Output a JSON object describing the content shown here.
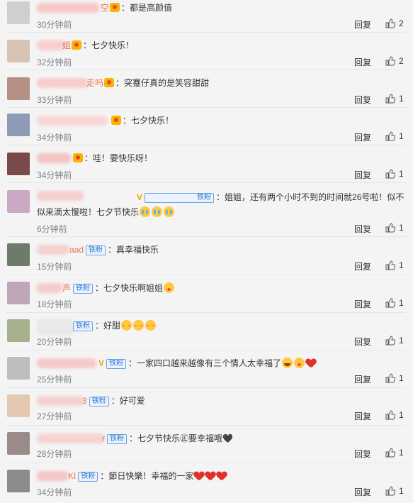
{
  "actions": {
    "reply_label": "回复"
  },
  "comments": [
    {
      "name": "空",
      "fan": "",
      "v": false,
      "text": "：都是高颜值",
      "time": "30分钟前",
      "likes": "2",
      "avatar_color": "#cfcfcf",
      "name_blur_color": "#f6c7c7"
    },
    {
      "name": "姐",
      "fan": "",
      "v": false,
      "text": "：七夕快乐！",
      "time": "32分钟前",
      "likes": "2",
      "avatar_color": "#d9c3b3",
      "name_blur_color": "#f7cfd0"
    },
    {
      "name": "走吗",
      "fan": "",
      "v": false,
      "text": "：突蹇仔真的是笑容甜甜",
      "time": "33分钟前",
      "likes": "1",
      "avatar_color": "#b58f83",
      "name_blur_color": "#f7cccc"
    },
    {
      "name": "",
      "fan": "",
      "v": false,
      "text": "：七夕快乐！",
      "time": "34分钟前",
      "likes": "1",
      "avatar_color": "#8e9bb5",
      "name_blur_color": "#f9d6d6"
    },
    {
      "name": "",
      "fan": "",
      "v": false,
      "text": "：哇！要快乐呀！",
      "time": "34分钟前",
      "likes": "1",
      "avatar_color": "#7a4a4a",
      "name_blur_color": "#f5c4c4"
    },
    {
      "name": "",
      "fan": "铁粉",
      "v": true,
      "text": "：姐姐，还有两个小时不到的时间就26号啦！似不似来滴太慢啦！七夕节快乐",
      "time": "6分钟前",
      "likes": "1",
      "avatar_color": "#c9a9c4",
      "name_blur_color": "#f6cfcf"
    },
    {
      "name": "aad",
      "fan": "铁粉",
      "v": false,
      "text": "：真幸福快乐",
      "time": "15分钟前",
      "likes": "1",
      "avatar_color": "#6f7b6a",
      "name_blur_color": "#f3d2d2"
    },
    {
      "name": "声",
      "fan": "铁粉",
      "v": false,
      "text": "：七夕快乐啊姐姐",
      "time": "18分钟前",
      "likes": "1",
      "avatar_color": "#bfa6b8",
      "name_blur_color": "#f5cccc"
    },
    {
      "name": "",
      "fan": "铁粉",
      "v": false,
      "text": "：好甜",
      "time": "20分钟前",
      "likes": "1",
      "avatar_color": "#a7b08c",
      "name_blur_color": "#e9e9e9"
    },
    {
      "name": "",
      "fan": "铁粉",
      "v": true,
      "text": "：一家四口越来越像有三个情人太幸福了",
      "time": "25分钟前",
      "likes": "1",
      "avatar_color": "#bdbdbd",
      "name_blur_color": "#f6c9c9"
    },
    {
      "name": "3",
      "fan": "铁粉",
      "v": false,
      "text": "：好可爱",
      "time": "27分钟前",
      "likes": "1",
      "avatar_color": "#e4c8b0",
      "name_blur_color": "#f5d0d0"
    },
    {
      "name": "r",
      "fan": "铁粉",
      "v": false,
      "text": "：七夕节快乐㊣要幸福哦🖤",
      "time": "28分钟前",
      "likes": "1",
      "avatar_color": "#9a8a8a",
      "name_blur_color": "#f6d3d3"
    },
    {
      "name": "KI",
      "fan": "铁粉",
      "v": false,
      "text": "：節日快樂！幸福的一家",
      "time": "34分钟前",
      "likes": "1",
      "avatar_color": "#8b8b8b",
      "name_blur_color": "#f3c6c6"
    }
  ]
}
